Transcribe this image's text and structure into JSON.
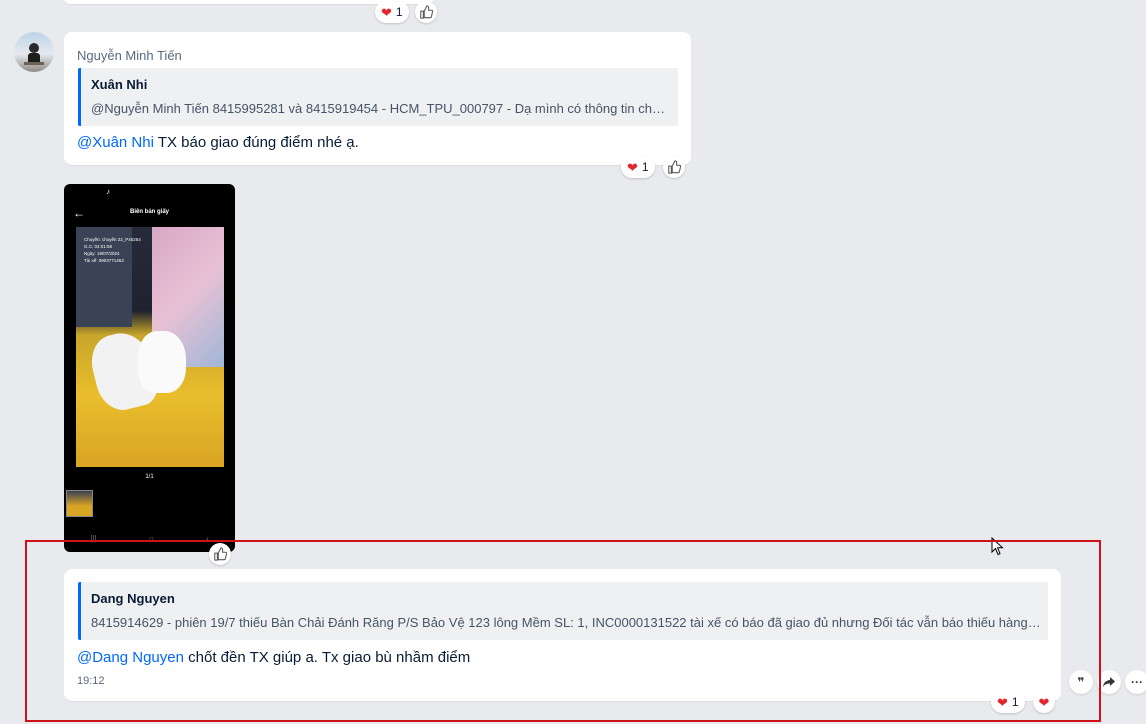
{
  "top_reactions": {
    "heart_count": "1"
  },
  "message1": {
    "sender": "Nguyễn Minh Tiến",
    "quote": {
      "author": "Xuân Nhi",
      "text": "@Nguyễn Minh Tiến 8415995281 và 8415919454 - HCM_TPU_000797 - Dạ mình có thông tin chưa ạ?"
    },
    "mention": "@Xuân Nhi",
    "text": " TX báo giao đúng điểm nhé ạ.",
    "heart_count": "1"
  },
  "image_message": {
    "screen_title": "Biên bản giấy",
    "overlay_lines": [
      "Chuyến: chuyến 22_P45254",
      "G.C: 04:01:58",
      "Ngày: 19/07/2024",
      "Tài xế: 0903771453"
    ],
    "page_indicator": "1/1",
    "tiktok_glyph": "♪"
  },
  "message2": {
    "quote": {
      "author": "Dang Nguyen",
      "text": "8415914629 - phiên 19/7 thiếu Bàn Chải Đánh Răng P/S Bảo Vệ 123 lông Mềm SL: 1, INC0000131522 tài xế có báo đã giao đủ nhưng Đối tác vẫn báo thiếu hàng, nh..."
    },
    "mention": "@Dang Nguyen",
    "text": " chốt đền TX giúp a. Tx giao bù nhầm điểm",
    "time": "19:12",
    "heart_count": "1"
  },
  "side_actions": {
    "quote_glyph": "❞",
    "more_glyph": "···"
  },
  "colors": {
    "accent": "#0068ff",
    "heart": "#e5262f",
    "highlight_box": "#d0101a"
  }
}
